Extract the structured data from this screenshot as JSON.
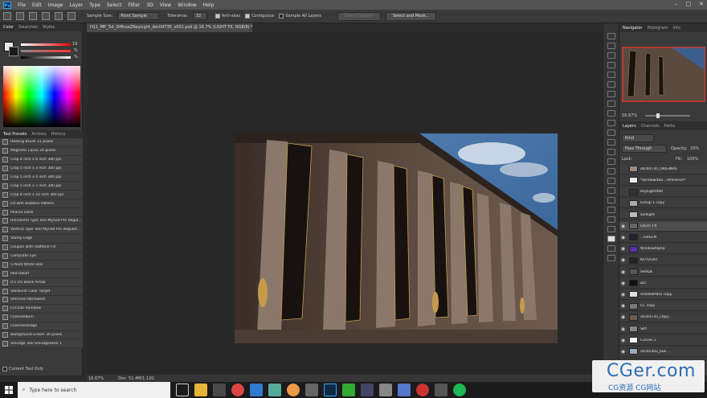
{
  "menubar": {
    "app_logo": "Ps",
    "items": [
      "File",
      "Edit",
      "Image",
      "Layer",
      "Type",
      "Select",
      "Filter",
      "3D",
      "View",
      "Window",
      "Help"
    ]
  },
  "options": {
    "sample_size_label": "Sample Size:",
    "sample_size_value": "Point Sample",
    "tolerance_label": "Tolerance:",
    "tolerance_value": "32",
    "anti_alias": "Anti-alias",
    "contiguous": "Contiguous",
    "sample_all_layers": "Sample All Layers",
    "select_subject": "Select Subject",
    "select_and_mask": "Select and Mask..."
  },
  "color_panel": {
    "tabs": [
      "Color",
      "Swatches",
      "Styles"
    ],
    "slider_values": [
      "19",
      "%",
      "%"
    ]
  },
  "presets_panel": {
    "tabs": [
      "Tool Presets",
      "Actions",
      "History"
    ],
    "items": [
      "Healing Brush 21 pixels",
      "Magnetic Lasso 24 pixels",
      "Crop 4 inch x 6 inch 300 ppi",
      "Crop 5 inch x 3 inch 300 ppi",
      "Crop 5 inch x 4 inch 300 ppi",
      "Crop 5 inch x 7 inch 300 ppi",
      "Crop 8 inch x 10 inch 300 ppi",
      "Fill with Bubbles Pattern",
      "Peanut Dash",
      "Horizontal Type Tool Myriad Pro Regul...",
      "Vertical Type Tool Myriad Pro Regular...",
      "Stamp Edge",
      "Coupon with Halftone Fill",
      "Computer Eye",
      "5 Point White Star",
      "Red Dwarf",
      "0.5 cm Black Arrow",
      "Starburst Color Target",
      "Stitched Patchwork",
      "Circular Rainbow",
      "ChannelBurn",
      "ChannelDodge",
      "Background Eraser 30 pixels",
      "Smudge Tool SmudgeStick 1"
    ],
    "footer_label": "Current Tool Only"
  },
  "document": {
    "tab_title": "H11_MP_Tut_DiffuseZKeyLight_dsc04735_v001.psd @ 16.7% (LIGHT FX, RGB/8) *",
    "zoom": "16.67%",
    "doc_size": "Doc: 51.4M/1.12G"
  },
  "navigator": {
    "tabs": [
      "Navigator",
      "Histogram",
      "Info"
    ],
    "zoom": "16.67%"
  },
  "layers_panel": {
    "tabs": [
      "Layers",
      "Channels",
      "Paths"
    ],
    "kind_label": "Kind",
    "blend_mode": "Pass Through",
    "opacity_label": "Opacity:",
    "opacity_value": "29%",
    "lock_label": "Lock:",
    "fill_label": "Fill:",
    "fill_value": "100%",
    "layers": [
      {
        "name": "dsc04735_ORIGINAL",
        "visible": false,
        "active": false
      },
      {
        "name": "*window/Dio...reference*",
        "visible": false,
        "active": false
      },
      {
        "name": "keyLightAdd",
        "visible": false,
        "active": false
      },
      {
        "name": "Group 1 copy",
        "visible": false,
        "active": false
      },
      {
        "name": "sunlight",
        "visible": false,
        "active": false
      },
      {
        "name": "LIGHT FX",
        "visible": true,
        "active": true
      },
      {
        "name": "...GREEN",
        "visible": true,
        "active": false
      },
      {
        "name": "WindowAlpha",
        "visible": true,
        "active": false
      },
      {
        "name": "KEYLIGHT",
        "visible": true,
        "active": false
      },
      {
        "name": "SHADE",
        "visible": true,
        "active": false
      },
      {
        "name": "acc",
        "visible": true,
        "active": false
      },
      {
        "name": "shadowPass copy",
        "visible": true,
        "active": false
      },
      {
        "name": "CC copy",
        "visible": true,
        "active": false
      },
      {
        "name": "dsc04735_copy...",
        "visible": true,
        "active": false
      },
      {
        "name": "SKY",
        "visible": true,
        "active": false
      },
      {
        "name": "Curves 2",
        "visible": true,
        "active": false
      },
      {
        "name": "dsc02302_kuk...",
        "visible": true,
        "active": false
      }
    ]
  },
  "taskbar": {
    "search_placeholder": "Type here to search"
  },
  "watermark": {
    "main": "CGer.com",
    "sub": "CG资源  CG网站"
  },
  "colors": {
    "accent": "#31a8ff",
    "active_layer": "#4e4e4e"
  }
}
